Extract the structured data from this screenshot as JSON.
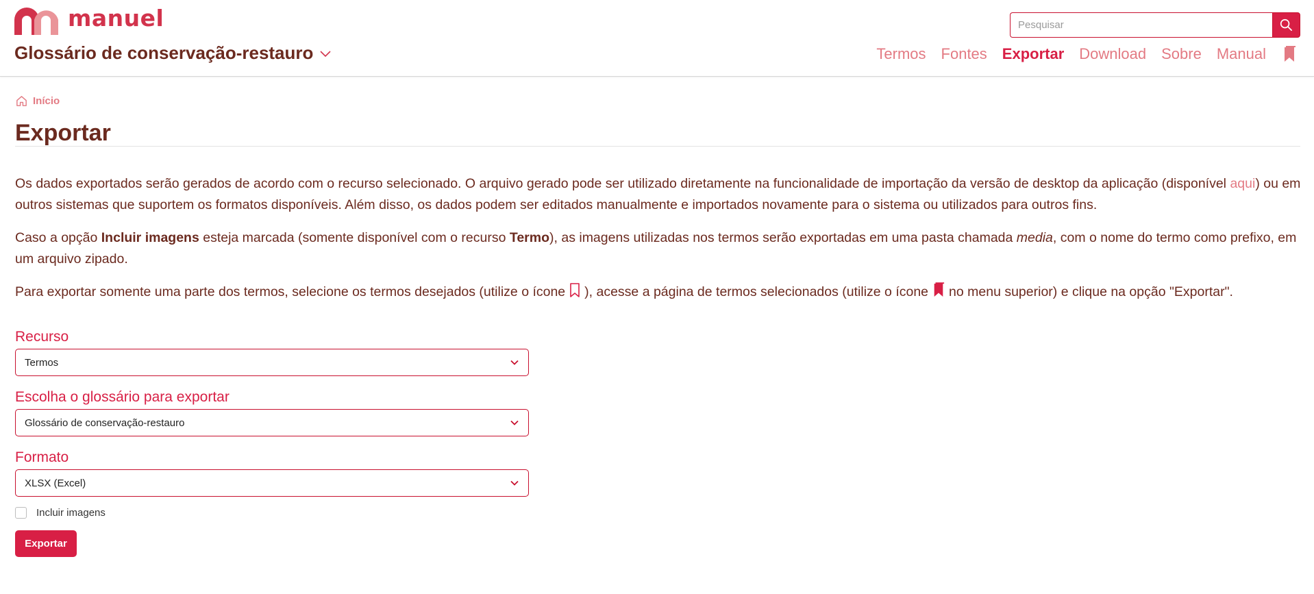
{
  "brand": {
    "name": "manuel",
    "accent": "#d81f45",
    "text_color": "#6b2a1f",
    "link_color": "#e37a83"
  },
  "header": {
    "app_title": "Glossário de conservação-restauro",
    "search": {
      "placeholder": "Pesquisar",
      "value": ""
    },
    "nav": [
      {
        "label": "Termos",
        "active": false
      },
      {
        "label": "Fontes",
        "active": false
      },
      {
        "label": "Exportar",
        "active": true
      },
      {
        "label": "Download",
        "active": false
      },
      {
        "label": "Sobre",
        "active": false
      },
      {
        "label": "Manual",
        "active": false
      }
    ],
    "bookmark_icon": "bookmark-filled-icon"
  },
  "breadcrumb": {
    "home_label": "Início"
  },
  "page": {
    "title": "Exportar",
    "p1": {
      "text_before": "Os dados exportados serão gerados de acordo com o recurso selecionado. O arquivo gerado pode ser utilizado diretamente na funcionalidade de importação da versão de desktop da aplicação (disponível ",
      "link": "aqui",
      "text_after": ") ou em outros sistemas que suportem os formatos disponíveis. Além disso, os dados podem ser editados manualmente e importados novamente para o sistema ou utilizados para outros fins."
    },
    "p2": {
      "t1": "Caso a opção ",
      "b1": "Incluir imagens",
      "t2": " esteja marcada (somente disponível com o recurso ",
      "b2": "Termo",
      "t3": "), as imagens utilizadas nos termos serão exportadas em uma pasta chamada ",
      "i1": "media",
      "t4": ", com o nome do termo como prefixo, em um arquivo zipado."
    },
    "p3": {
      "t1": "Para exportar somente uma parte dos termos, selecione os termos desejados (utilize o ícone",
      "t2": "), acesse a página de termos selecionados (utilize o ícone",
      "t3": "no menu superior) e clique na opção \"Exportar\"."
    }
  },
  "form": {
    "resource": {
      "label": "Recurso",
      "value": "Termos"
    },
    "glossary": {
      "label": "Escolha o glossário para exportar",
      "value": "Glossário de conservação-restauro"
    },
    "format": {
      "label": "Formato",
      "value": "XLSX (Excel)"
    },
    "include_images": {
      "label": "Incluir imagens",
      "checked": false
    },
    "submit_label": "Exportar"
  }
}
